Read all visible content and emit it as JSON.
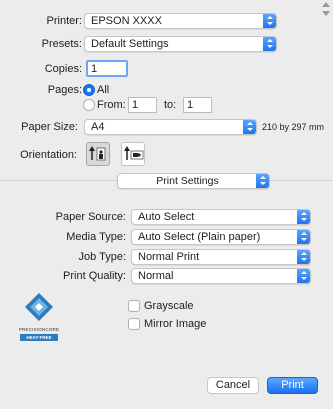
{
  "printer": {
    "label": "Printer:",
    "value": "EPSON XXXX"
  },
  "presets": {
    "label": "Presets:",
    "value": "Default Settings"
  },
  "copies": {
    "label": "Copies:",
    "value": "1"
  },
  "pages": {
    "label": "Pages:",
    "all_label": "All",
    "from_label": "From:",
    "from_value": "1",
    "to_label": "to:",
    "to_value": "1",
    "selected": "All"
  },
  "paper_size": {
    "label": "Paper Size:",
    "value": "A4",
    "dimensions": "210 by 297 mm"
  },
  "orientation": {
    "label": "Orientation:",
    "selected": "portrait"
  },
  "section": {
    "value": "Print Settings"
  },
  "paper_source": {
    "label": "Paper Source:",
    "value": "Auto Select"
  },
  "media_type": {
    "label": "Media Type:",
    "value": "Auto Select (Plain paper)"
  },
  "job_type": {
    "label": "Job Type:",
    "value": "Normal Print"
  },
  "print_quality": {
    "label": "Print Quality:",
    "value": "Normal"
  },
  "logo": {
    "line1": "PRECISIONCORE",
    "line2": "HEAT-FREE"
  },
  "grayscale": {
    "label": "Grayscale",
    "checked": false
  },
  "mirror_image": {
    "label": "Mirror Image",
    "checked": false
  },
  "buttons": {
    "cancel": "Cancel",
    "print": "Print"
  },
  "colors": {
    "accent": "#1a72f0",
    "background": "#ececec"
  }
}
